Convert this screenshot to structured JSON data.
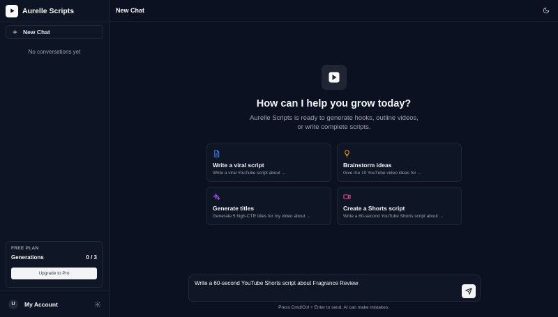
{
  "brand": {
    "name": "Aurelle Scripts"
  },
  "sidebar": {
    "new_chat_label": "New Chat",
    "empty_text": "No conversations yet",
    "plan": {
      "tier": "FREE PLAN",
      "generations_label": "Generations",
      "generations_value": "0 / 3",
      "upgrade_label": "Upgrade to Pro"
    },
    "account": {
      "initial": "U",
      "label": "My Account"
    }
  },
  "topbar": {
    "title": "New Chat"
  },
  "hero": {
    "title": "How can I help you grow today?",
    "subtitle_line1": "Aurelle Scripts is ready to generate hooks, outline videos,",
    "subtitle_line2": "or write complete scripts."
  },
  "suggestions": [
    {
      "icon": "document-icon",
      "color": "#3b82f6",
      "title": "Write a viral script",
      "desc": "Write a viral YouTube script about ..."
    },
    {
      "icon": "lightbulb-icon",
      "color": "#f59e0b",
      "title": "Brainstorm ideas",
      "desc": "Give me 10 YouTube video ideas for ..."
    },
    {
      "icon": "sparkles-icon",
      "color": "#a855f7",
      "title": "Generate titles",
      "desc": "Generate 5 high-CTR titles for my video about ..."
    },
    {
      "icon": "video-icon",
      "color": "#ec4899",
      "title": "Create a Shorts script",
      "desc": "Write a 60-second YouTube Shorts script about ..."
    }
  ],
  "composer": {
    "value": "Write a 60-second YouTube Shorts script about Fragrance Review",
    "footnote": "Press Cmd/Ctrl + Enter to send. AI can make mistakes."
  }
}
